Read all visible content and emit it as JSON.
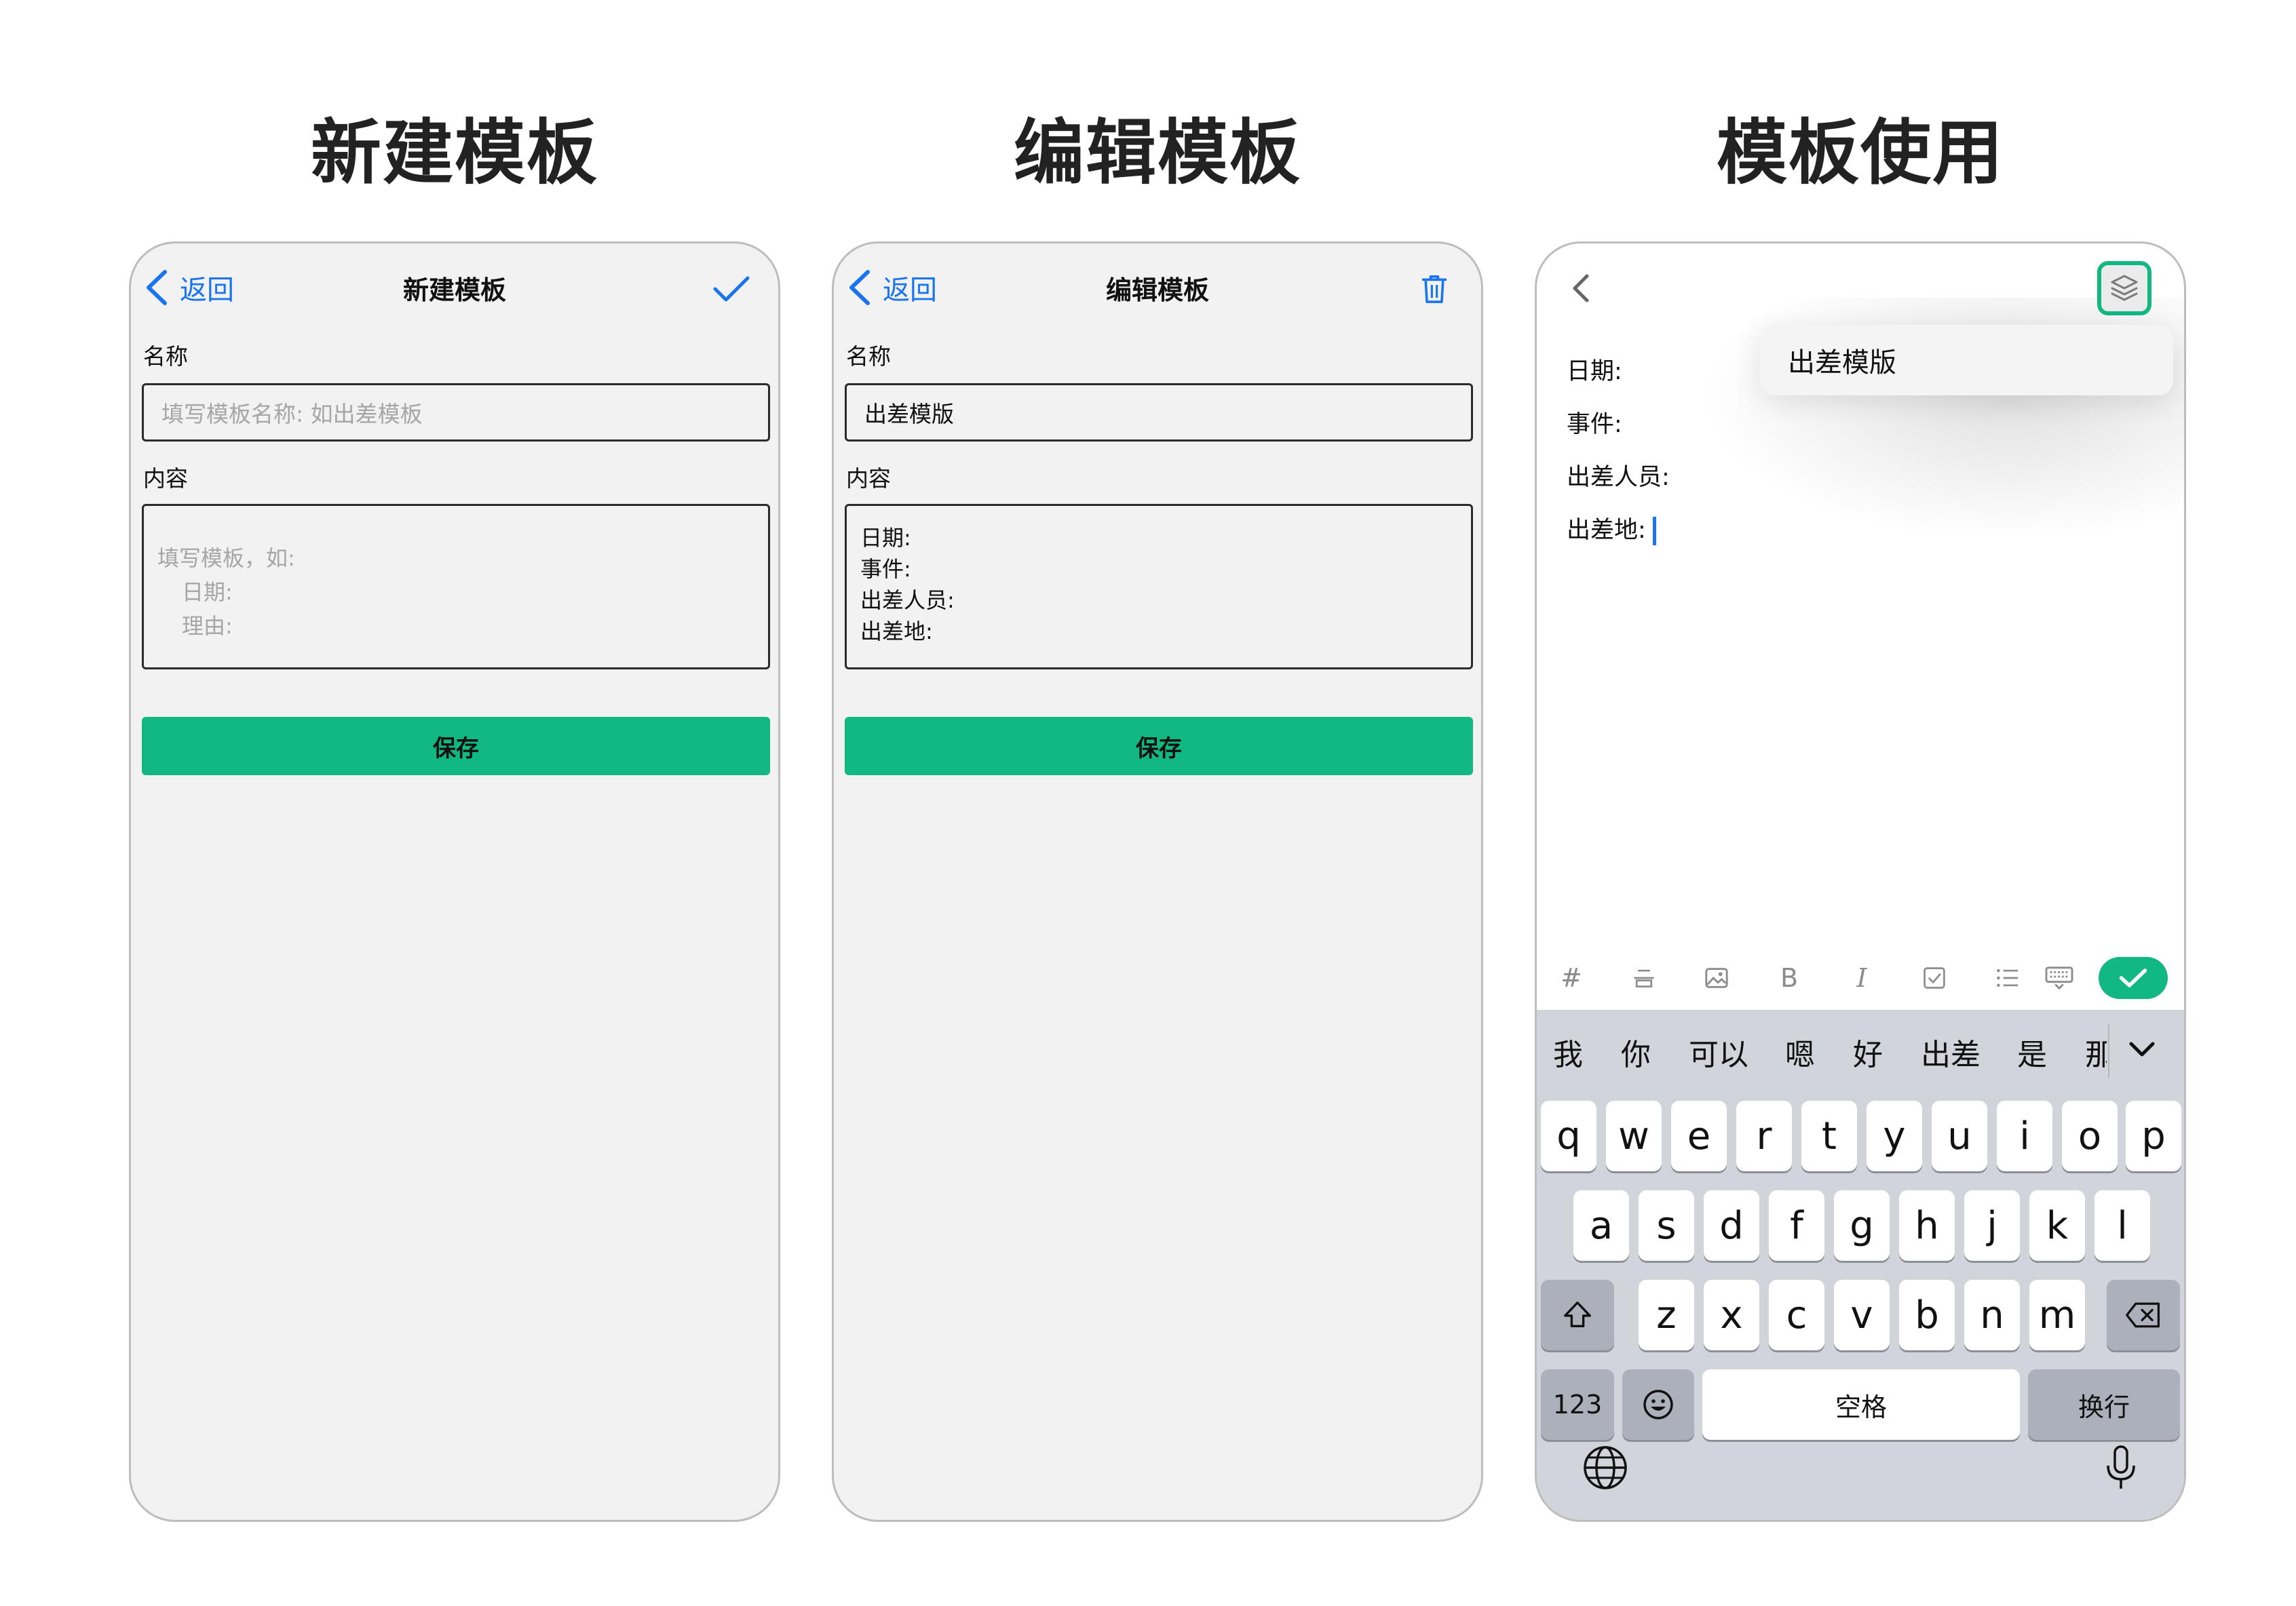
{
  "headings": [
    "新建模板",
    "编辑模板",
    "模板使用"
  ],
  "colors": {
    "accent_green": "#12b882",
    "link_blue": "#1a74f0",
    "screen_bg": "#f2f2f2",
    "keyboard_bg": "#d1d4db"
  },
  "new_screen": {
    "back_label": "返回",
    "title": "新建模板",
    "confirm_icon": "checkmark-icon",
    "name_label": "名称",
    "name_placeholder": "填写模板名称: 如出差模板",
    "content_label": "内容",
    "content_placeholder": [
      "填写模板，如:",
      "日期:",
      "理由:"
    ],
    "save_label": "保存"
  },
  "edit_screen": {
    "back_label": "返回",
    "title": "编辑模板",
    "delete_icon": "trash-icon",
    "name_label": "名称",
    "name_value": "出差模版",
    "content_label": "内容",
    "content_lines": [
      "日期:",
      "事件:",
      "出差人员:",
      "出差地:"
    ],
    "save_label": "保存"
  },
  "use_screen": {
    "template_menu_item": "出差模版",
    "note_lines": [
      "日期:",
      "事件:",
      "出差人员:",
      "出差地:"
    ],
    "format_icons": [
      "hash-icon",
      "strikethrough-icon",
      "image-icon",
      "bold-icon",
      "italic-icon",
      "checkbox-icon",
      "list-icon",
      "keyboard-icon"
    ],
    "format_glyphs": {
      "hash": "#",
      "bold": "B",
      "italic": "I"
    },
    "candidates": [
      "我",
      "你",
      "可以",
      "嗯",
      "好",
      "出差",
      "是",
      "那"
    ],
    "keyboard": {
      "row1": [
        "q",
        "w",
        "e",
        "r",
        "t",
        "y",
        "u",
        "i",
        "o",
        "p"
      ],
      "row2": [
        "a",
        "s",
        "d",
        "f",
        "g",
        "h",
        "j",
        "k",
        "l"
      ],
      "row3": [
        "z",
        "x",
        "c",
        "v",
        "b",
        "n",
        "m"
      ],
      "numbers_label": "123",
      "space_label": "空格",
      "return_label": "换行"
    }
  }
}
